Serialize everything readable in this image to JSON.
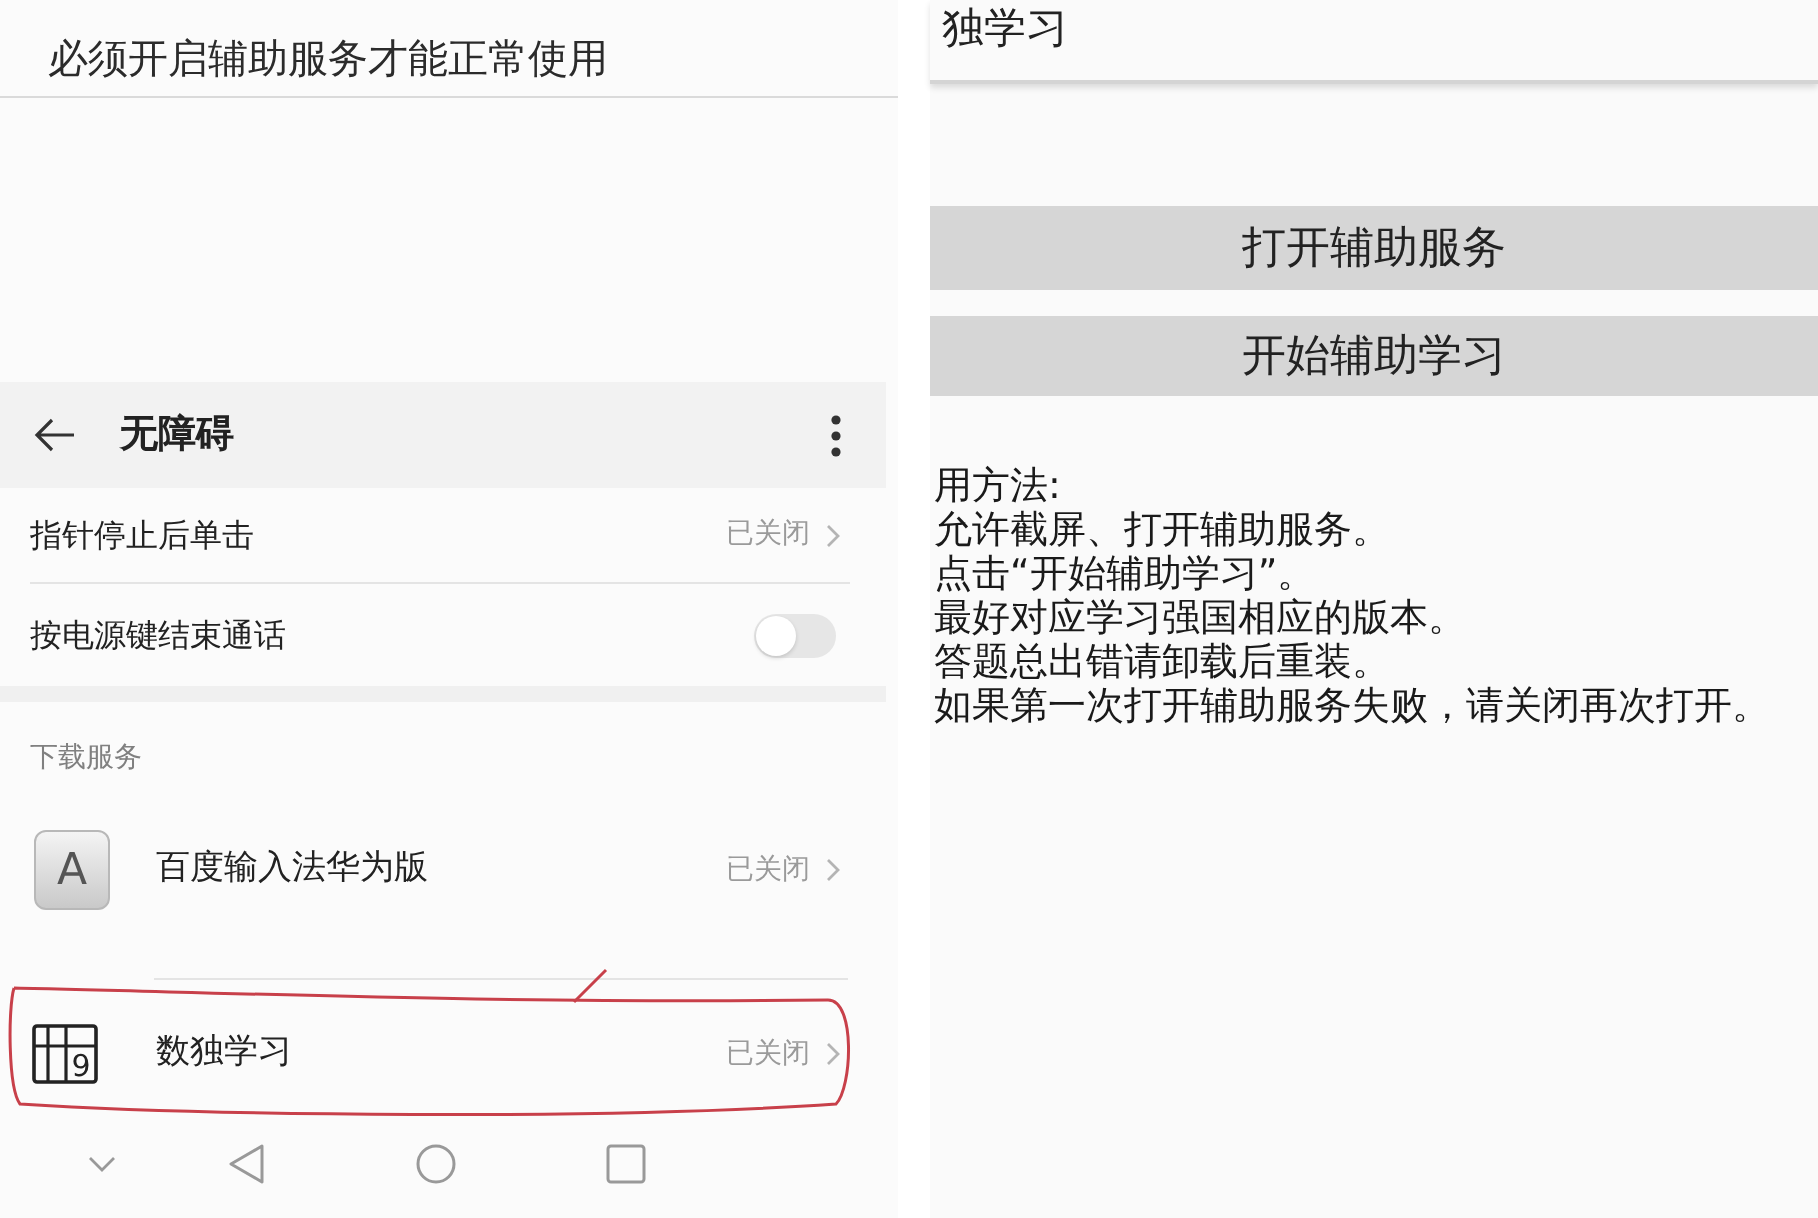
{
  "left_screen": {
    "notice": "必须开启辅助服务才能正常使用",
    "header": {
      "title": "无障碍"
    },
    "settings": [
      {
        "kind": "link",
        "label": "指针停止后单击",
        "status": "已关闭"
      },
      {
        "kind": "switch",
        "label": "按电源键结束通话",
        "on": false
      }
    ],
    "section_title": "下载服务",
    "services": [
      {
        "kind": "tile",
        "icon_text": "A",
        "label": "百度输入法华为版",
        "status": "已关闭",
        "circled": false
      },
      {
        "kind": "grid",
        "icon_text": "9",
        "label": "数独学习",
        "status": "已关闭",
        "circled": true
      }
    ]
  },
  "right_screen": {
    "title": "独学习",
    "buttons": [
      "打开辅助服务",
      "开始辅助学习"
    ],
    "instructions_heading": "用方法:",
    "instructions": [
      "允许截屏、打开辅助服务。",
      "点击“开始辅助学习”。",
      "最好对应学习强国相应的版本。",
      "答题总出错请卸载后重装。",
      "如果第一次打开辅助服务失败，请关闭再次打开。"
    ]
  }
}
